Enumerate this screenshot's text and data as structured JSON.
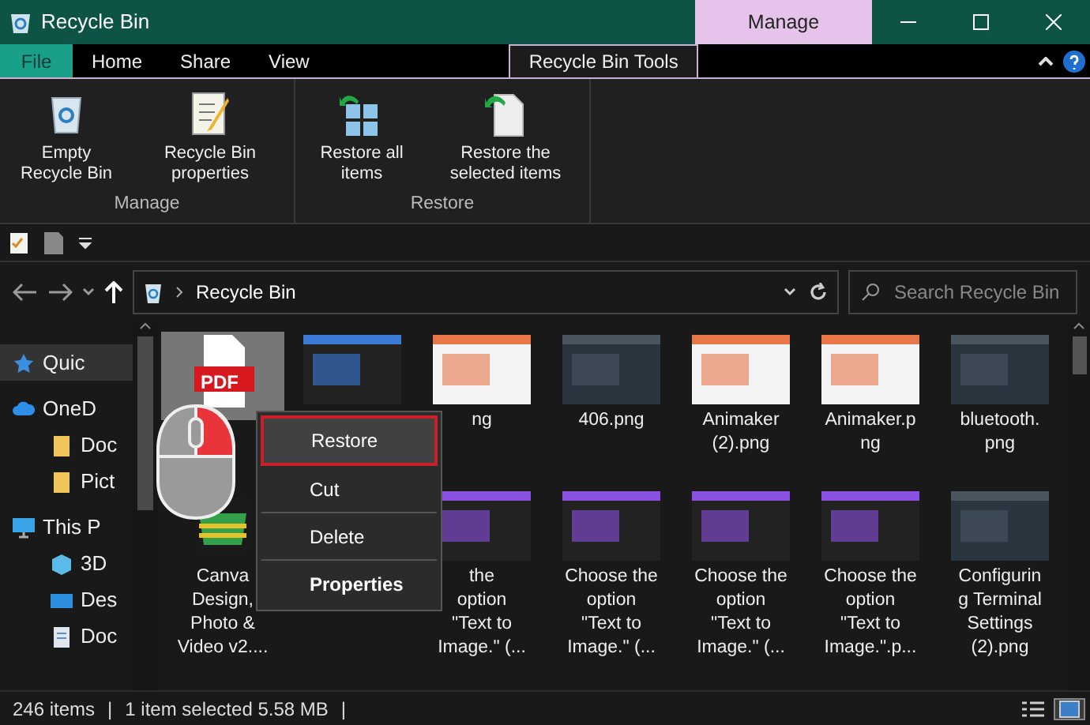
{
  "window": {
    "title": "Recycle Bin",
    "context_tab": "Manage"
  },
  "ribbon_tabs": [
    {
      "label": "File",
      "kind": "file",
      "selected": false
    },
    {
      "label": "Home",
      "kind": "tab",
      "selected": false
    },
    {
      "label": "Share",
      "kind": "tab",
      "selected": false
    },
    {
      "label": "View",
      "kind": "tab",
      "selected": false
    },
    {
      "label": "Recycle Bin Tools",
      "kind": "tab",
      "selected": true
    }
  ],
  "ribbon_groups": [
    {
      "label": "Manage",
      "buttons": [
        {
          "label": "Empty Recycle Bin",
          "kind": "bin"
        },
        {
          "label": "Recycle Bin properties",
          "kind": "properties"
        }
      ]
    },
    {
      "label": "Restore",
      "buttons": [
        {
          "label": "Restore all items",
          "kind": "restore-all"
        },
        {
          "label": "Restore the selected items",
          "kind": "restore-selected"
        }
      ]
    }
  ],
  "address": {
    "path": "Recycle Bin"
  },
  "search": {
    "placeholder": "Search Recycle Bin"
  },
  "sidebar": {
    "items": [
      {
        "label": "Quic",
        "kind": "star",
        "selected": true
      },
      {
        "label": "OneD",
        "kind": "cloud",
        "selected": false,
        "children": [
          {
            "label": "Doc",
            "kind": "folder",
            "selected": false
          },
          {
            "label": "Pict",
            "kind": "folder",
            "selected": false
          }
        ]
      },
      {
        "label": "This P",
        "kind": "pc",
        "selected": false,
        "children": [
          {
            "label": "3D",
            "kind": "cube",
            "selected": false
          },
          {
            "label": "Des",
            "kind": "desktop",
            "selected": false
          },
          {
            "label": "Doc",
            "kind": "document",
            "selected": false
          }
        ]
      }
    ]
  },
  "files": [
    {
      "items": [
        {
          "kind": "pdf",
          "badge": "PDF",
          "selected": true
        },
        {
          "kind": "code",
          "selected": false
        },
        {
          "kind": "light",
          "selected": false,
          "caption": [
            "ng"
          ]
        },
        {
          "kind": "dark",
          "selected": false,
          "caption": [
            "406.png"
          ]
        },
        {
          "kind": "light",
          "selected": false,
          "caption": [
            "Animaker",
            "(2).png"
          ]
        },
        {
          "kind": "light",
          "selected": false,
          "caption": [
            "Animaker.p",
            "ng"
          ]
        },
        {
          "kind": "dark",
          "selected": false,
          "caption": [
            "bluetooth.",
            "png"
          ]
        }
      ]
    },
    {
      "items": [
        {
          "kind": "app",
          "selected": false,
          "caption": [
            "Canva",
            "Design,",
            "Photo &",
            "Video v2...."
          ]
        },
        {
          "kind": "site",
          "selected": false,
          "caption": [
            "the",
            "option",
            "\"Text to",
            "Image.\" (..."
          ]
        },
        {
          "kind": "site",
          "selected": false,
          "caption": [
            "Choose the",
            "option",
            "\"Text to",
            "Image.\" (..."
          ]
        },
        {
          "kind": "site",
          "selected": false,
          "caption": [
            "Choose the",
            "option",
            "\"Text to",
            "Image.\" (..."
          ]
        },
        {
          "kind": "site",
          "selected": false,
          "caption": [
            "Choose the",
            "option",
            "\"Text to",
            "Image.\".p..."
          ]
        },
        {
          "kind": "dark",
          "selected": false,
          "caption": [
            "Configurin",
            "g Terminal",
            "Settings",
            "(2).png"
          ]
        }
      ]
    }
  ],
  "context_menu": {
    "items": [
      {
        "label": "Restore",
        "selected": true,
        "bold": false
      },
      {
        "label": "Cut",
        "selected": false,
        "bold": false
      },
      {
        "label": "Delete",
        "selected": false,
        "bold": false
      },
      {
        "label": "Properties",
        "selected": false,
        "bold": true
      }
    ]
  },
  "status_bar": {
    "parts": [
      "246 items",
      "|",
      "1 item selected  5.58 MB",
      "|"
    ]
  },
  "view_buttons": [
    {
      "kind": "details",
      "selected": false
    },
    {
      "kind": "large-icons",
      "selected": true
    }
  ]
}
